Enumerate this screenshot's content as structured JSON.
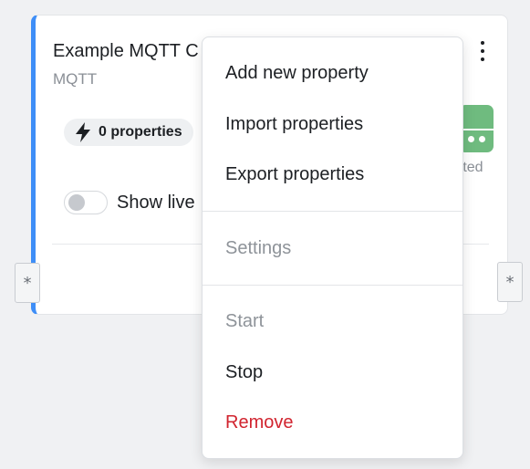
{
  "card": {
    "title": "Example MQTT C",
    "subtitle": "MQTT",
    "properties_chip": "0 properties",
    "toggle_label": "Show live",
    "status_text": "rted",
    "accent_color": "#3e8ef7",
    "status_color": "#6fbb7f",
    "icons": {
      "properties": "bolt-icon",
      "menu": "kebab-menu-icon",
      "status": "status-icon"
    }
  },
  "ports": {
    "left_label": "*",
    "right_label": "*"
  },
  "menu": {
    "items": [
      {
        "label": "Add new property",
        "enabled": true
      },
      {
        "label": "Import properties",
        "enabled": true
      },
      {
        "label": "Export properties",
        "enabled": true
      },
      {
        "label": "Settings",
        "enabled": false
      },
      {
        "label": "Start",
        "enabled": false
      },
      {
        "label": "Stop",
        "enabled": true
      },
      {
        "label": "Remove",
        "enabled": true,
        "danger": true
      }
    ],
    "danger_color": "#d1242f"
  }
}
